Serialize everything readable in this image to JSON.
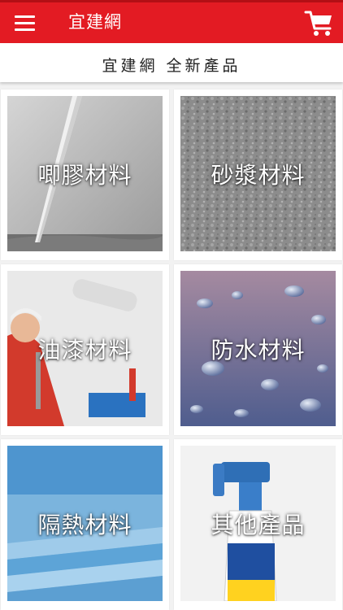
{
  "app": {
    "title": "宜建網",
    "brand_color": "#e31b23"
  },
  "toolbar": {
    "menu_icon": "hamburger-menu-icon",
    "cart_icon": "shopping-cart-icon"
  },
  "subheader": {
    "text": "宜建網 全新產品"
  },
  "categories": [
    {
      "label": "唧膠材料",
      "image": "caulking-gun-photo"
    },
    {
      "label": "砂漿材料",
      "image": "mortar-texture-photo"
    },
    {
      "label": "油漆材料",
      "image": "paint-roller-photo"
    },
    {
      "label": "防水材料",
      "image": "water-droplets-photo"
    },
    {
      "label": "隔熱材料",
      "image": "insulation-boards-photo"
    },
    {
      "label": "其他產品",
      "image": "spray-bottle-photo"
    }
  ]
}
